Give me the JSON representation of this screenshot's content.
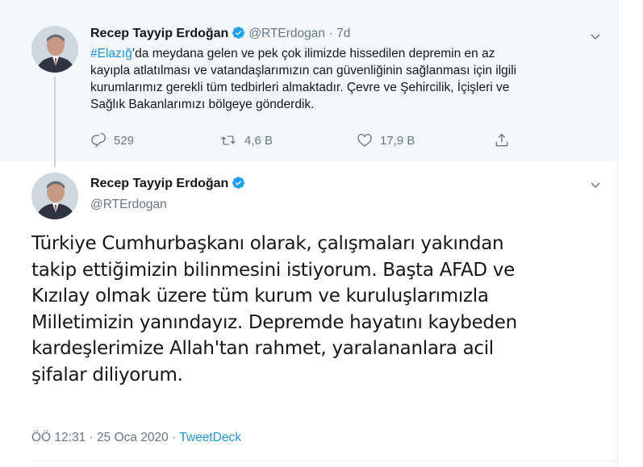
{
  "parent_tweet": {
    "author_name": "Recep Tayyip Erdoğan",
    "handle": "@RTErdogan",
    "separator": "·",
    "age": "7d",
    "hashtag": "#Elazığ",
    "text_lines": [
      "’da meydana gelen ve pek çok ilimizde hissedilen depremin en az",
      "kayıpla atlatılması ve vatandaşlarımızın can güvenliğinin sağlanması için ilgili",
      "kurumlarımız gerekli tüm tedbirleri almaktadır. Çevre ve Şehircilik, İçişleri ve",
      "Sağlık Bakanlarımızı bölgeye gönderdik."
    ],
    "reply_count": "529",
    "retweet_count": "4,6 B",
    "like_count": "17,9 B"
  },
  "main_tweet": {
    "author_name": "Recep Tayyip Erdoğan",
    "handle": "@RTErdogan",
    "text_lines": [
      "Türkiye Cumhurbaşkanı olarak, çalışmaları yakından",
      "takip ettiğimizin bilinmesini istiyorum. Başta AFAD ve",
      "Kızılay olmak üzere tüm kurum ve kuruluşlarımızla",
      "Milletimizin yanındayız. Depremde hayatını kaybeden",
      "kardeşlerimize Allah'tan rahmet, yaralananlara acil",
      "şifalar diliyorum."
    ],
    "time": "ÖÖ 12:31",
    "dot": "·",
    "date": "25 Oca 2020",
    "dot2": "·",
    "source": "TweetDeck"
  },
  "icons": [
    "verified-badge-icon",
    "chevron-down-icon",
    "reply-icon",
    "retweet-icon",
    "like-icon",
    "share-icon"
  ],
  "colors": {
    "accent": "#1b95e0",
    "muted": "#657786",
    "text": "#14171a",
    "parent_bg": "#f5f8fa",
    "border": "#e6ecf0"
  }
}
